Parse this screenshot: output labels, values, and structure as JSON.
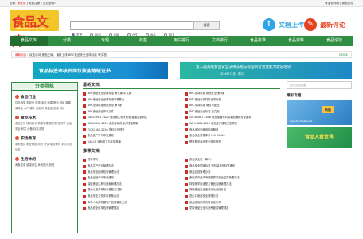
{
  "topbar": {
    "left": "您好,",
    "login": "请登录",
    "free": "免费注册",
    "forgot": "忘记密码?",
    "right": "食品伙伴网 | 食品论坛"
  },
  "logo": {
    "title": "食品文库",
    "sub": "wenku.foodmate.net"
  },
  "search": {
    "placeholder": "",
    "button": "搜索"
  },
  "filters": [
    "全部",
    "DOC",
    "PDF",
    "PPT",
    "XLS",
    "TXT"
  ],
  "upload": {
    "label": "文档上传",
    "icon": "upload-icon"
  },
  "comments": {
    "label": "最新评论",
    "icon": "chat-icon"
  },
  "nav": [
    "食品文库",
    "分类",
    "专题",
    "标签",
    "用户排行",
    "文档排行",
    "食品标准",
    "食品资料",
    "食品论坛"
  ],
  "announce": {
    "label": "最新动态：",
    "text": "欢迎访问 食品文库，最新上传 BRC食品安全全球标准 等文档",
    "more": "MORE"
  },
  "banner1": "食品标签审核员岗位技能等级证书",
  "banner2": {
    "title": "第二届海南食品安全法律法规与标准研讨会暨能力建设培训",
    "sub": "2024年11月 · 海口"
  },
  "sidebar": {
    "title": "分类导航",
    "cats": [
      {
        "name": "食品行业",
        "items": "饮料酒类 乳制品 肉类 禽蛋 蔬果 粮油 焙烤 糖果 调味品 水产 罐头 添加剂 保健品 包装 其他"
      },
      {
        "name": "食品技术",
        "items": "食品工艺 检测技术 质量管理 微生物 营养学 食品安全 研发 设备 标准法规"
      },
      {
        "name": "职场教育",
        "items": "求职面试 职业规划 简历 考试 培训资料 学习方法 论文"
      },
      {
        "name": "生活休闲",
        "items": "美食菜谱 健康养生 休闲娱乐 其他"
      }
    ]
  },
  "recent": {
    "title": "最新文档",
    "items": [
      "BRC食品安全全球标准 第九版 中文版",
      "BRC全球标准 食品安全 第8版",
      "BRC食品安全全球标准审核要点",
      "BRC食品包装材料全球标准",
      "BRC全球标准食品安全 第7版",
      "BRC全球标准 储存与配送",
      "BRC食品安全体系文件",
      "BRC食品安全标准 英文版",
      "GB 4789.2-2022 食品微生物学检验 菌落总数测定",
      "GB 4806.1-2016 食品接触材料及制品通用安全要求",
      "GB 31650-2019 食品中兽药最大残留限量",
      "GB 14881-2013 食品生产通用卫生规范",
      "T/CBJ 001-2020 饮料行业规范",
      "食品添加剂使用标准解读",
      "食品生产许可审查通则",
      "食品安全管理体系 ISO 22000",
      "HACCP 体系建立与实施指南",
      "餐饮服务食品安全操作规范"
    ]
  },
  "recommend": {
    "title": "推荐文档",
    "items": [
      "资料学习",
      "食品安全法（释义）",
      "食品生产许可管理办法",
      "食品安全国家标准 预包装食品标签通则",
      "食品安全抽样检验管理办法",
      "食品召回管理办法",
      "食品经营许可审查通则",
      "食用农产品市场销售质量安全监督管理办法",
      "保健食品注册与备案管理办法",
      "特殊医学用途配方食品注册管理办法",
      "婴幼儿配方乳粉产品配方注册",
      "网络食品安全违法行为查处办法",
      "食品安全工作评议考核办法",
      "进出口食品安全管理办法",
      "中华人民共和国农产品质量安全法",
      "食品检验机构资质认定条件",
      "食品安全信用档案管理规定",
      "学校食品安全与营养健康管理规定"
    ]
  },
  "right": {
    "search": "站内文档搜索",
    "title": "精彩专题",
    "img1_badge": "新版",
    "img1_url": "www.foodmate.net",
    "img2": "食品人看世界"
  },
  "colors": {
    "nav": "#2f8e42",
    "accent": "#e1251b",
    "upload": "#2fa4e7",
    "comments": "#e8411f"
  }
}
